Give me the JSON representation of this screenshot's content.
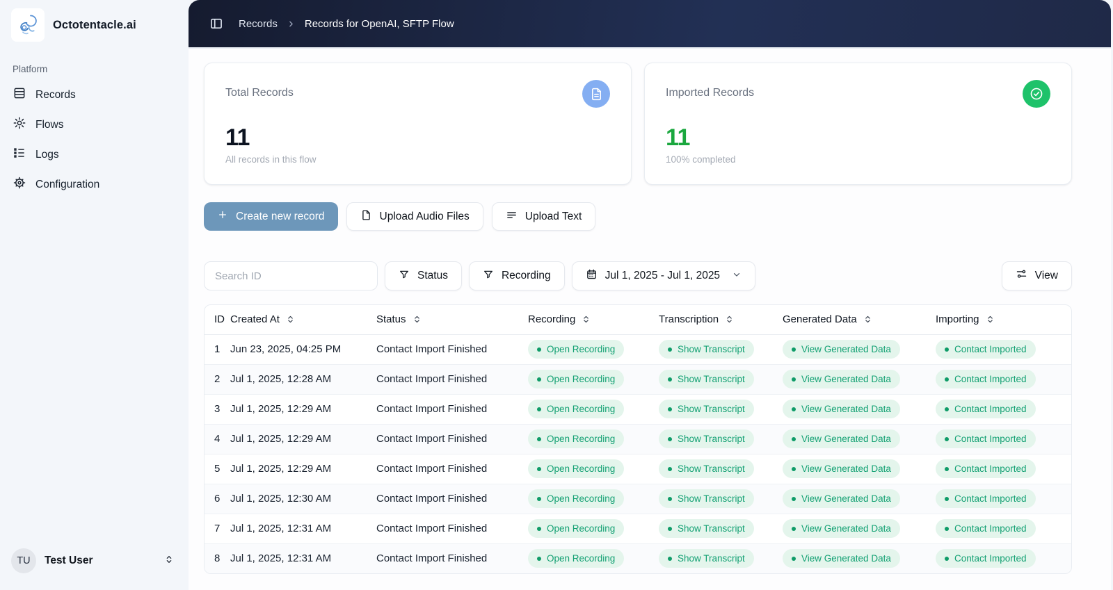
{
  "brand": {
    "name": "Octotentacle.ai",
    "logo_icon": "octopus-logo-icon"
  },
  "sidebar": {
    "section_label": "Platform",
    "items": [
      {
        "label": "Records",
        "icon": "records-icon"
      },
      {
        "label": "Flows",
        "icon": "flows-gear-icon"
      },
      {
        "label": "Logs",
        "icon": "logs-list-icon"
      },
      {
        "label": "Configuration",
        "icon": "configuration-gear-icon"
      }
    ],
    "user": {
      "initials": "TU",
      "name": "Test User",
      "icon": "chevron-up-down-icon"
    }
  },
  "breadcrumb": {
    "section": "Records",
    "page": "Records for OpenAI, SFTP Flow",
    "toggle_icon": "panel-left-icon"
  },
  "stats": [
    {
      "title": "Total Records",
      "value": "11",
      "subtitle": "All records in this flow",
      "icon": "document-icon",
      "icon_bg": "#84aef2",
      "value_color": "#0c1320"
    },
    {
      "title": "Imported Records",
      "value": "11",
      "subtitle": "100% completed",
      "icon": "check-circle-icon",
      "icon_bg": "#1ec26a",
      "value_color": "#1aa73e"
    }
  ],
  "actions": {
    "create_label": "Create new record",
    "upload_audio_label": "Upload Audio Files",
    "upload_text_label": "Upload Text"
  },
  "filters": {
    "search_placeholder": "Search ID",
    "status_label": "Status",
    "recording_label": "Recording",
    "date_range": "Jul 1, 2025 - Jul 1, 2025",
    "view_label": "View"
  },
  "table": {
    "columns": [
      {
        "label": "ID",
        "sortable": false
      },
      {
        "label": "Created At",
        "sortable": true
      },
      {
        "label": "Status",
        "sortable": true
      },
      {
        "label": "Recording",
        "sortable": true
      },
      {
        "label": "Transcription",
        "sortable": true
      },
      {
        "label": "Generated Data",
        "sortable": true
      },
      {
        "label": "Importing",
        "sortable": true
      }
    ],
    "rows": [
      {
        "id": "1",
        "created_at": "Jun 23, 2025, 04:25 PM",
        "status": "Contact Import Finished",
        "recording": "Open Recording",
        "transcription": "Show Transcript",
        "generated_data": "View Generated Data",
        "importing": "Contact Imported"
      },
      {
        "id": "2",
        "created_at": "Jul 1, 2025, 12:28 AM",
        "status": "Contact Import Finished",
        "recording": "Open Recording",
        "transcription": "Show Transcript",
        "generated_data": "View Generated Data",
        "importing": "Contact Imported"
      },
      {
        "id": "3",
        "created_at": "Jul 1, 2025, 12:29 AM",
        "status": "Contact Import Finished",
        "recording": "Open Recording",
        "transcription": "Show Transcript",
        "generated_data": "View Generated Data",
        "importing": "Contact Imported"
      },
      {
        "id": "4",
        "created_at": "Jul 1, 2025, 12:29 AM",
        "status": "Contact Import Finished",
        "recording": "Open Recording",
        "transcription": "Show Transcript",
        "generated_data": "View Generated Data",
        "importing": "Contact Imported"
      },
      {
        "id": "5",
        "created_at": "Jul 1, 2025, 12:29 AM",
        "status": "Contact Import Finished",
        "recording": "Open Recording",
        "transcription": "Show Transcript",
        "generated_data": "View Generated Data",
        "importing": "Contact Imported"
      },
      {
        "id": "6",
        "created_at": "Jul 1, 2025, 12:30 AM",
        "status": "Contact Import Finished",
        "recording": "Open Recording",
        "transcription": "Show Transcript",
        "generated_data": "View Generated Data",
        "importing": "Contact Imported"
      },
      {
        "id": "7",
        "created_at": "Jul 1, 2025, 12:31 AM",
        "status": "Contact Import Finished",
        "recording": "Open Recording",
        "transcription": "Show Transcript",
        "generated_data": "View Generated Data",
        "importing": "Contact Imported"
      },
      {
        "id": "8",
        "created_at": "Jul 1, 2025, 12:31 AM",
        "status": "Contact Import Finished",
        "recording": "Open Recording",
        "transcription": "Show Transcript",
        "generated_data": "View Generated Data",
        "importing": "Contact Imported"
      }
    ]
  },
  "colors": {
    "primary_button": "#6d97ba",
    "badge_bg": "#e4f5ec",
    "badge_text": "#13a173",
    "badge_dot": "#0f9c68",
    "stat_green": "#1aa73e",
    "stat_icon_blue": "#84aef2",
    "stat_icon_green": "#1ec26a",
    "topbar_gradient_start": "#151b2f",
    "topbar_gradient_end": "#1f2947",
    "sidebar_bg": "#f3f6fa"
  }
}
